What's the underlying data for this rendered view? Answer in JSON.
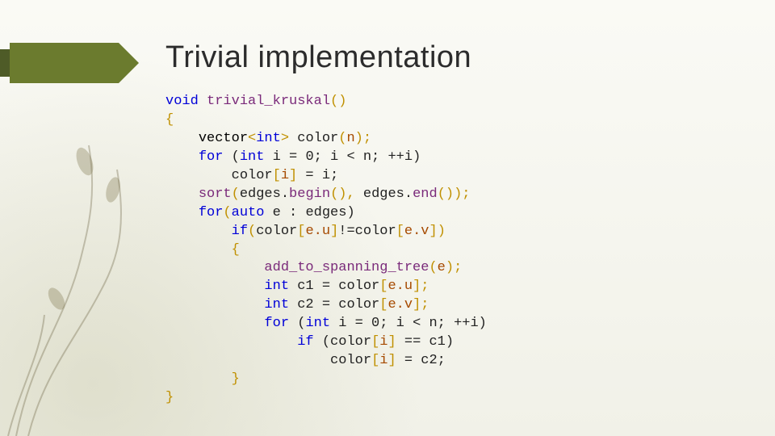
{
  "title": "Trivial implementation",
  "code": {
    "l01_kw_void": "void",
    "l01_fn": "trivial_kruskal",
    "l01_paren_open": "(",
    "l01_paren_close": ")",
    "l02_brace": "{",
    "l03_vector": "vector",
    "l03_lt": "<",
    "l03_int": "int",
    "l03_gt": ">",
    "l03_color": " color",
    "l03_open": "(",
    "l03_n": "n",
    "l03_close_semi": ");",
    "l04_for": "for",
    "l04_rest1": " (",
    "l04_int": "int",
    "l04_rest2": " i = 0; i < n; ++i)",
    "l05_color": "        color",
    "l05_br1": "[",
    "l05_i": "i",
    "l05_br2": "]",
    "l05_rest": " = i;",
    "l06_sort": "sort",
    "l06_open": "(",
    "l06_edges1": "edges",
    "l06_dot1": ".",
    "l06_begin": "begin",
    "l06_parens1": "(), ",
    "l06_edges2": "edges",
    "l06_dot2": ".",
    "l06_end": "end",
    "l06_parens2": "());",
    "l07_for": "for",
    "l07_open": "(",
    "l07_auto": "auto",
    "l07_rest": " e : edges)",
    "l08_if": "if",
    "l08_open": "(",
    "l08_color1": "color",
    "l08_br1": "[",
    "l08_eu": "e.u",
    "l08_br2": "]",
    "l08_neq": "!=",
    "l08_color2": "color",
    "l08_br3": "[",
    "l08_ev": "e.v",
    "l08_br4": "])",
    "l09_brace": "{",
    "l10_fn": "add_to_spanning_tree",
    "l10_open": "(",
    "l10_e": "e",
    "l10_close": ");",
    "l11_int": "int",
    "l11_c1": " c1 = color",
    "l11_br1": "[",
    "l11_eu": "e.u",
    "l11_br2": "];",
    "l12_int": "int",
    "l12_c2": " c2 = color",
    "l12_br1": "[",
    "l12_ev": "e.v",
    "l12_br2": "];",
    "l13_for": "for",
    "l13_open": " (",
    "l13_int": "int",
    "l13_rest": " i = 0; i < n; ++i)",
    "l14_if": "if",
    "l14_rest1": " (color",
    "l14_br1": "[",
    "l14_i": "i",
    "l14_br2": "]",
    "l14_rest2": " == c1)",
    "l15_color": "color",
    "l15_br1": "[",
    "l15_i": "i",
    "l15_br2": "]",
    "l15_rest": " = c2;",
    "l16_brace": "}",
    "l17_brace": "}"
  }
}
